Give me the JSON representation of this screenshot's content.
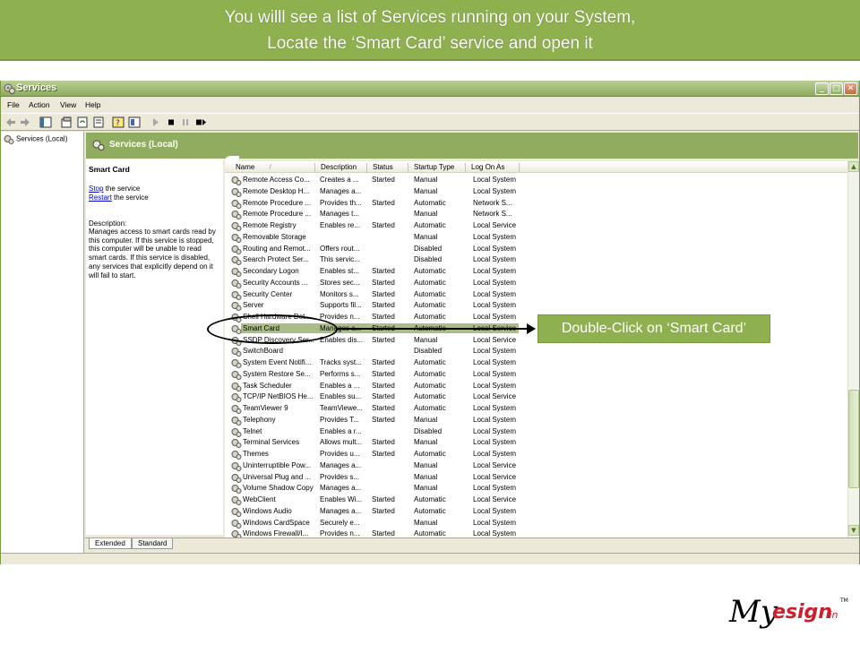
{
  "banner": {
    "line1": "You willl see a list of Services running on your System,",
    "line2": "Locate the ‘Smart Card’ service and open it"
  },
  "window": {
    "title": "Services",
    "buttons": {
      "minimize": "_",
      "maximize": "□",
      "close": "✕"
    }
  },
  "menu": [
    "File",
    "Action",
    "View",
    "Help"
  ],
  "toolbar": {
    "icons": [
      "back-icon",
      "forward-icon",
      "show-hide-tree-icon",
      "properties-icon",
      "refresh-icon",
      "export-list-icon",
      "help-icon",
      "view-icon",
      "start-service-icon",
      "stop-service-icon",
      "pause-service-icon",
      "restart-service-icon"
    ]
  },
  "tree": {
    "root_label": "Services (Local)"
  },
  "content_header": {
    "title": "Services (Local)"
  },
  "detail": {
    "name": "Smart Card",
    "stop_link": "Stop",
    "stop_suffix": " the service",
    "restart_link": "Restart",
    "restart_suffix": " the service",
    "desc_label": "Description:",
    "desc_text": "Manages access to smart cards read by this computer. If this service is stopped, this computer will be unable to read smart cards. If this service is disabled, any services that explicitly depend on it will fail to start."
  },
  "table": {
    "columns": [
      "Name",
      "Description",
      "Status",
      "Startup Type",
      "Log On As"
    ],
    "sort_indicator": "/",
    "rows": [
      [
        "Remote Access Co...",
        "Creates a ...",
        "Started",
        "Manual",
        "Local System"
      ],
      [
        "Remote Desktop H...",
        "Manages a...",
        "",
        "Manual",
        "Local System"
      ],
      [
        "Remote Procedure ...",
        "Provides th...",
        "Started",
        "Automatic",
        "Network S..."
      ],
      [
        "Remote Procedure ...",
        "Manages t...",
        "",
        "Manual",
        "Network S..."
      ],
      [
        "Remote Registry",
        "Enables re...",
        "Started",
        "Automatic",
        "Local Service"
      ],
      [
        "Removable Storage",
        "",
        "",
        "Manual",
        "Local System"
      ],
      [
        "Routing and Remot...",
        "Offers rout...",
        "",
        "Disabled",
        "Local System"
      ],
      [
        "Search Protect Ser...",
        "This servic...",
        "",
        "Disabled",
        "Local System"
      ],
      [
        "Secondary Logon",
        "Enables st...",
        "Started",
        "Automatic",
        "Local System"
      ],
      [
        "Security Accounts ...",
        "Stores sec...",
        "Started",
        "Automatic",
        "Local System"
      ],
      [
        "Security Center",
        "Monitors s...",
        "Started",
        "Automatic",
        "Local System"
      ],
      [
        "Server",
        "Supports fil...",
        "Started",
        "Automatic",
        "Local System"
      ],
      [
        "Shell Hardware Det...",
        "Provides n...",
        "Started",
        "Automatic",
        "Local System"
      ],
      [
        "Smart Card",
        "Manages a...",
        "Started",
        "Automatic",
        "Local Service"
      ],
      [
        "SSDP Discovery Ser...",
        "Enables dis...",
        "Started",
        "Manual",
        "Local Service"
      ],
      [
        "SwitchBoard",
        "",
        "",
        "Disabled",
        "Local System"
      ],
      [
        "System Event Notifi...",
        "Tracks syst...",
        "Started",
        "Automatic",
        "Local System"
      ],
      [
        "System Restore Se...",
        "Performs s...",
        "Started",
        "Automatic",
        "Local System"
      ],
      [
        "Task Scheduler",
        "Enables a ...",
        "Started",
        "Automatic",
        "Local System"
      ],
      [
        "TCP/IP NetBIOS He...",
        "Enables su...",
        "Started",
        "Automatic",
        "Local Service"
      ],
      [
        "TeamViewer 9",
        "TeamViewe...",
        "Started",
        "Automatic",
        "Local System"
      ],
      [
        "Telephony",
        "Provides T...",
        "Started",
        "Manual",
        "Local System"
      ],
      [
        "Telnet",
        "Enables a r...",
        "",
        "Disabled",
        "Local System"
      ],
      [
        "Terminal Services",
        "Allows mult...",
        "Started",
        "Manual",
        "Local System"
      ],
      [
        "Themes",
        "Provides u...",
        "Started",
        "Automatic",
        "Local System"
      ],
      [
        "Uninterruptible Pow...",
        "Manages a...",
        "",
        "Manual",
        "Local Service"
      ],
      [
        "Universal Plug and ...",
        "Provides s...",
        "",
        "Manual",
        "Local Service"
      ],
      [
        "Volume Shadow Copy",
        "Manages a...",
        "",
        "Manual",
        "Local System"
      ],
      [
        "WebClient",
        "Enables Wi...",
        "Started",
        "Automatic",
        "Local Service"
      ],
      [
        "Windows Audio",
        "Manages a...",
        "Started",
        "Automatic",
        "Local System"
      ],
      [
        "Windows CardSpace",
        "Securely e...",
        "",
        "Manual",
        "Local System"
      ],
      [
        "Windows Firewall/I...",
        "Provides n...",
        "Started",
        "Automatic",
        "Local System"
      ]
    ],
    "selected_row_index": 13
  },
  "tabs": [
    "Extended",
    "Standard"
  ],
  "callout": {
    "text": "Double-Click  on ‘Smart Card’"
  },
  "logo": {
    "text_my": "My",
    "text_esign": "esign",
    "text_in": ".in",
    "tm": "TM"
  },
  "colors": {
    "accent": "#8fb04e",
    "selection": "#95ad69",
    "link": "#0000cc"
  }
}
